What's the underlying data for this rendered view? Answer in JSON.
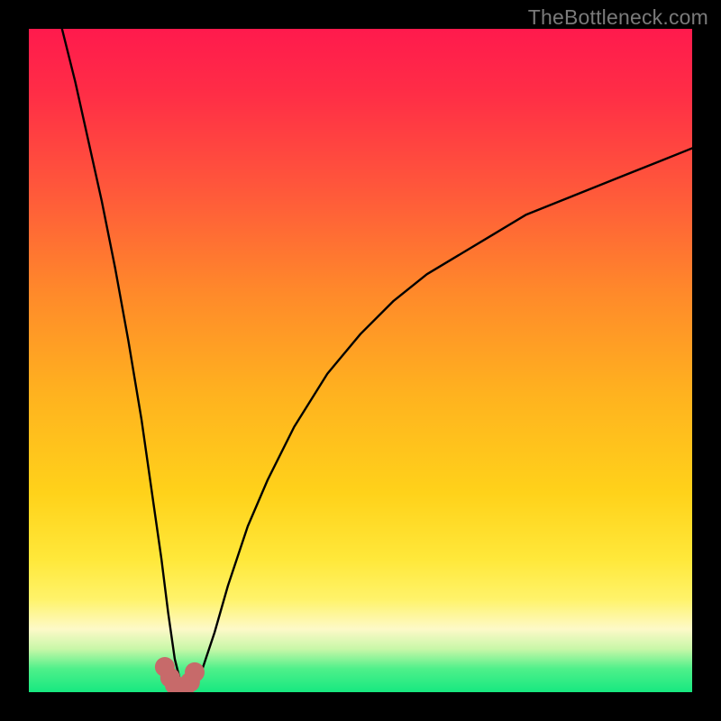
{
  "watermark": "TheBottleneck.com",
  "colors": {
    "frame": "#000000",
    "gradient_stops": [
      {
        "offset": 0.0,
        "color": "#ff1a4d"
      },
      {
        "offset": 0.1,
        "color": "#ff2e46"
      },
      {
        "offset": 0.25,
        "color": "#ff5a3a"
      },
      {
        "offset": 0.4,
        "color": "#ff8a2a"
      },
      {
        "offset": 0.55,
        "color": "#ffb21f"
      },
      {
        "offset": 0.7,
        "color": "#ffd21a"
      },
      {
        "offset": 0.8,
        "color": "#ffe83a"
      },
      {
        "offset": 0.86,
        "color": "#fff36a"
      },
      {
        "offset": 0.905,
        "color": "#fdf9c8"
      },
      {
        "offset": 0.935,
        "color": "#c8f7a8"
      },
      {
        "offset": 0.965,
        "color": "#4ef08a"
      },
      {
        "offset": 1.0,
        "color": "#17e880"
      }
    ],
    "curve": "#000000",
    "marker_fill": "#c76a6a",
    "marker_stroke": "#a84f4f"
  },
  "chart_data": {
    "type": "line",
    "title": "",
    "xlabel": "",
    "ylabel": "",
    "xlim": [
      0,
      100
    ],
    "ylim": [
      0,
      100
    ],
    "note": "Axes are unlabeled; values are the approximate (x, y%) positions of the plotted curve read from the image, where y=100 is the top (red) edge and y=0 the bottom (green) edge. The curve dips to ~0 near x≈23 then rises toward ~82 at x=100.",
    "series": [
      {
        "name": "curve",
        "x": [
          5,
          7,
          9,
          11,
          13,
          15,
          17,
          19,
          20,
          21,
          22,
          23,
          24,
          25,
          26,
          28,
          30,
          33,
          36,
          40,
          45,
          50,
          55,
          60,
          65,
          70,
          75,
          80,
          85,
          90,
          95,
          100
        ],
        "y": [
          100,
          92,
          83,
          74,
          64,
          53,
          41,
          27,
          20,
          12,
          5,
          1,
          0.5,
          1,
          3,
          9,
          16,
          25,
          32,
          40,
          48,
          54,
          59,
          63,
          66,
          69,
          72,
          74,
          76,
          78,
          80,
          82
        ]
      }
    ],
    "markers": {
      "name": "highlighted-dip",
      "x": [
        20.5,
        21.3,
        22.0,
        22.8,
        23.5,
        24.3,
        25.0
      ],
      "y": [
        3.8,
        2.2,
        1.1,
        0.6,
        0.7,
        1.5,
        3.0
      ],
      "size": 11
    }
  }
}
